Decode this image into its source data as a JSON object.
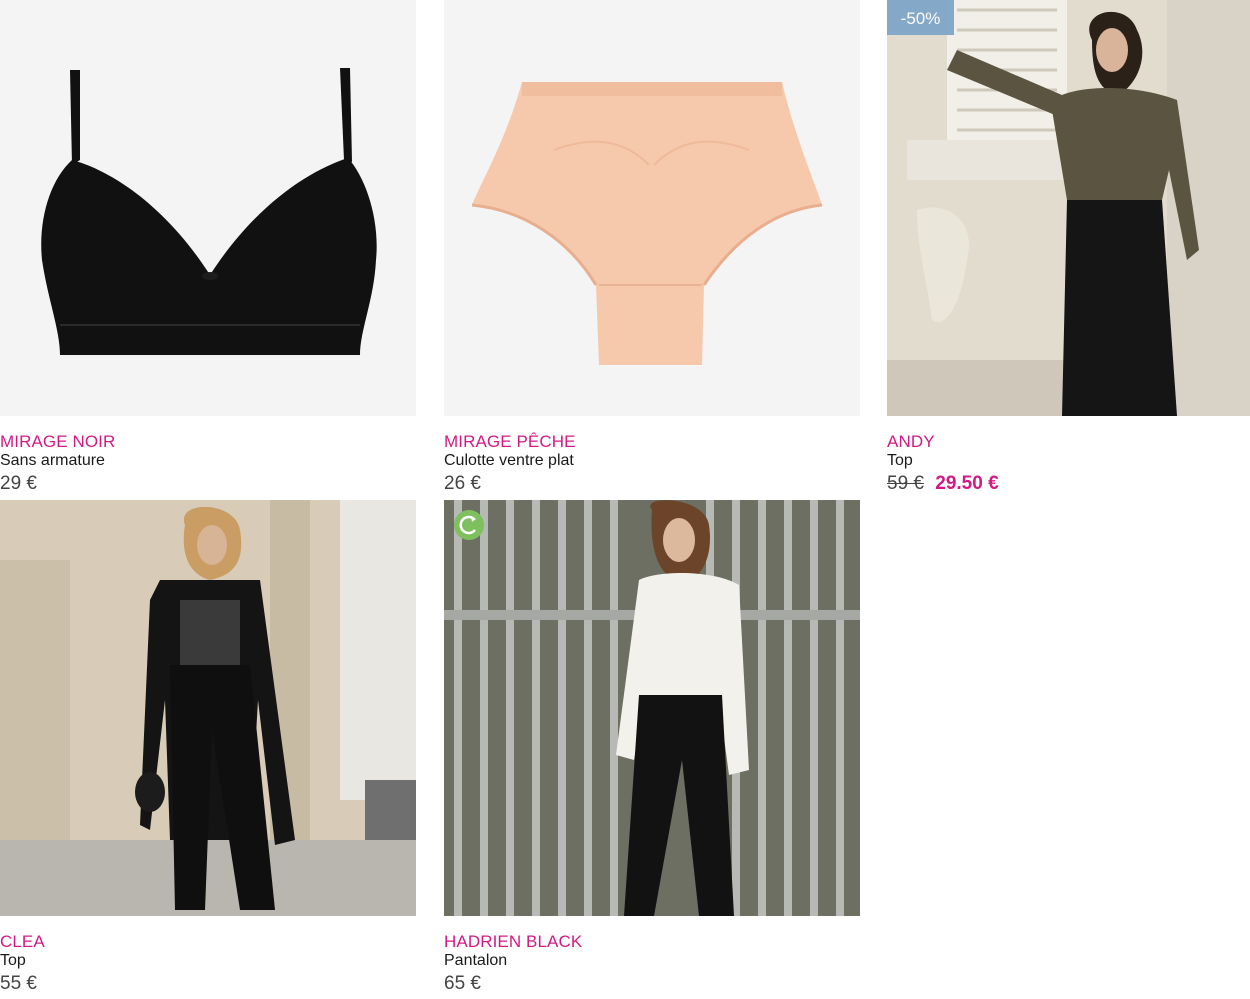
{
  "products": [
    {
      "name": "MIRAGE NOIR",
      "type": "Sans armature",
      "price": "29 €"
    },
    {
      "name": "MIRAGE PÊCHE",
      "type": "Culotte ventre plat",
      "price": "26 €"
    },
    {
      "name": "ANDY",
      "type": "Top",
      "old_price": "59 €",
      "new_price": "29.50 €",
      "badge": "-50%"
    },
    {
      "name": "CLEA",
      "type": "Top",
      "price": "55 €"
    },
    {
      "name": "HADRIEN BLACK",
      "type": "Pantalon",
      "price": "65 €",
      "badge_icon": "eco-leaf-icon"
    }
  ],
  "colors": {
    "accent": "#d21a85",
    "discount_badge": "#7fa6c8",
    "eco_badge": "#7ec05d"
  }
}
